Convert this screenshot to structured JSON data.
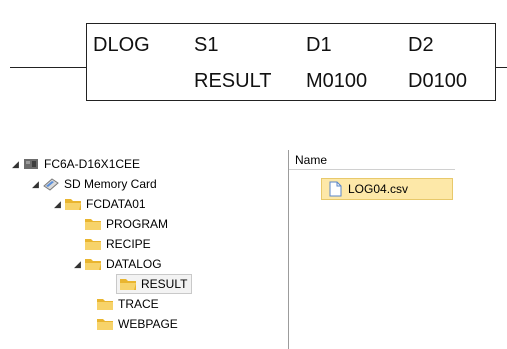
{
  "ladder": {
    "instruction": "DLOG",
    "operands": [
      {
        "header": "S1",
        "value": "RESULT"
      },
      {
        "header": "D1",
        "value": "M0100"
      },
      {
        "header": "D2",
        "value": "D0100"
      }
    ]
  },
  "tree": {
    "items": [
      {
        "label": "FC6A-D16X1CEE",
        "icon": "plc-device-icon",
        "expanded": true
      },
      {
        "label": "SD Memory Card",
        "icon": "sd-card-icon",
        "expanded": true
      },
      {
        "label": "FCDATA01",
        "icon": "folder-icon",
        "expanded": true
      },
      {
        "label": "PROGRAM",
        "icon": "folder-icon"
      },
      {
        "label": "RECIPE",
        "icon": "folder-icon"
      },
      {
        "label": "DATALOG",
        "icon": "folder-icon",
        "expanded": true
      },
      {
        "label": "RESULT",
        "icon": "folder-icon",
        "selected": true
      },
      {
        "label": "TRACE",
        "icon": "folder-icon"
      },
      {
        "label": "WEBPAGE",
        "icon": "folder-icon"
      }
    ]
  },
  "list": {
    "column_header": "Name",
    "files": [
      {
        "name": "LOG04.csv",
        "icon": "csv-file-icon",
        "selected": true
      }
    ]
  },
  "colors": {
    "folder": "#f5c542",
    "selection": "#fde8a8"
  }
}
